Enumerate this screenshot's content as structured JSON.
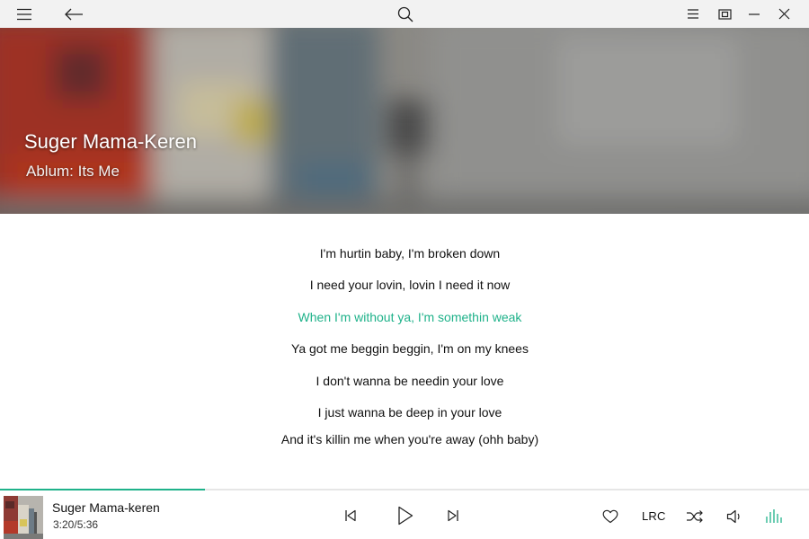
{
  "titlebar": {
    "icons": [
      "menu-icon",
      "back-arrow-icon",
      "search-icon",
      "list-icon",
      "mini-mode-icon",
      "minimize-icon",
      "close-icon"
    ]
  },
  "hero": {
    "title": "Suger Mama-Keren",
    "album": "Ablum: Its Me"
  },
  "lyrics": [
    "I'm hurtin baby, I'm broken down",
    "I need your lovin, lovin I need it now",
    "When I'm without ya, I'm somethin weak",
    "Ya got me beggin beggin, I'm on my knees",
    "I don't wanna be needin your love",
    "I just wanna be deep in your love",
    "And it's killin me when you're away (ohh baby)"
  ],
  "current_lyric_index": 2,
  "player": {
    "title": "Suger Mama-keren",
    "time": "3:20/5:36",
    "progress": 0.253,
    "lrc_label": "LRC",
    "controls": [
      "previous-icon",
      "play-icon",
      "next-icon",
      "heart-icon",
      "shuffle-icon",
      "volume-icon",
      "equalizer-icon"
    ]
  },
  "colors": {
    "accent": "#1fb28a",
    "titlebar_bg": "#f2f2f2",
    "text": "#111111"
  }
}
